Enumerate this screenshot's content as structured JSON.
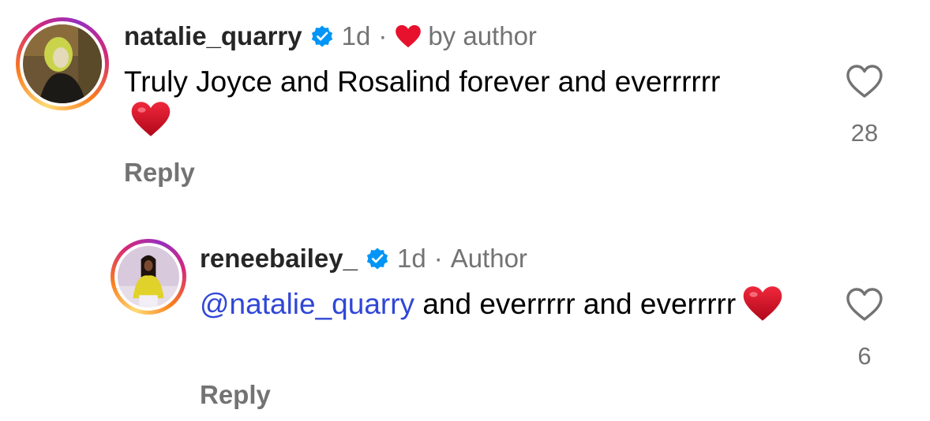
{
  "colors": {
    "username": "#262626",
    "meta": "#737373",
    "mention": "#3047d6",
    "verified_badge": "#0095f6",
    "heart_red": "#e8112d"
  },
  "comments": [
    {
      "username": "natalie_quarry",
      "verified": true,
      "time": "1d",
      "separator": "·",
      "liked_by_author_label": "by author",
      "liked_by_author_icon": "red-heart-icon",
      "text": "Truly Joyce and Rosalind forever and everrrrrr",
      "text_emoji": "red-heart-emoji",
      "reply_label": "Reply",
      "like_icon": "heart-outline-icon",
      "like_count": "28"
    },
    {
      "username": "reneebailey_",
      "verified": true,
      "time": "1d",
      "separator": "·",
      "author_badge": "Author",
      "mention": "@natalie_quarry",
      "text": " and everrrrr and everrrrr",
      "text_emoji": "red-heart-emoji",
      "reply_label": "Reply",
      "like_icon": "heart-outline-icon",
      "like_count": "6"
    }
  ]
}
